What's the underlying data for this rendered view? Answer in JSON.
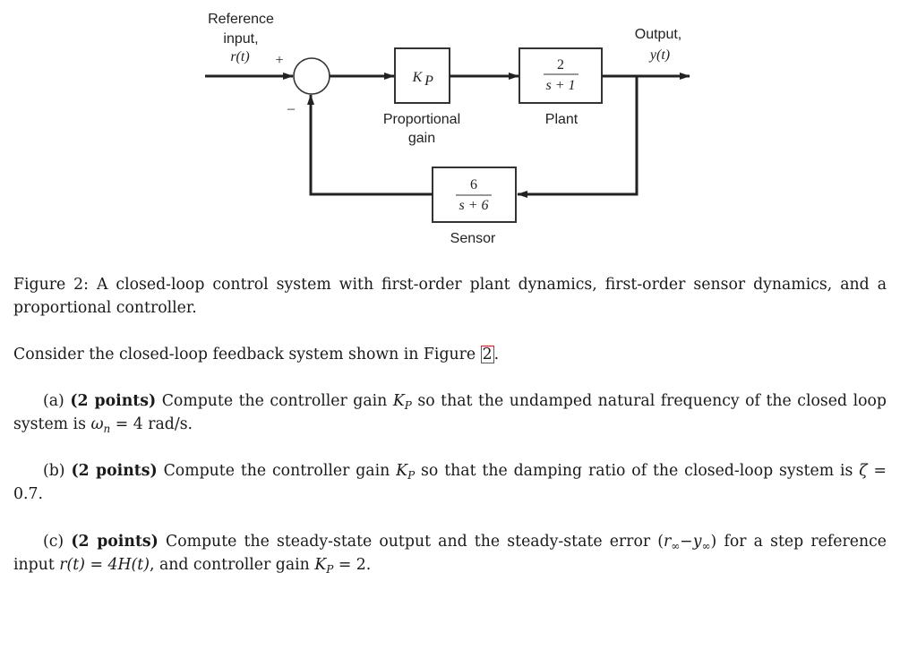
{
  "diagram": {
    "reference_label": [
      "Reference",
      "input,",
      "r(t)"
    ],
    "plus_sign": "+",
    "minus_sign": "–",
    "controller": {
      "symbol": "K",
      "subscript": "P",
      "caption": [
        "Proportional",
        "gain"
      ]
    },
    "plant": {
      "numerator": "2",
      "denominator": "s + 1",
      "caption": "Plant"
    },
    "sensor": {
      "numerator": "6",
      "denominator": "s + 6",
      "caption": "Sensor"
    },
    "output_label": [
      "Output,",
      "y(t)"
    ]
  },
  "caption": {
    "label": "Figure 2:",
    "text": "A closed-loop control system with first-order plant dynamics, first-order sensor dynamics, and a proportional controller."
  },
  "intro": {
    "before": "Consider the closed-loop feedback system shown in Figure",
    "ref": "2",
    "after": "."
  },
  "questions": [
    {
      "id": "(a)",
      "points": "(2 points)",
      "before": "Compute the controller gain",
      "kp": "K",
      "kp_sub": "P",
      "after": "so that the undamped natural frequency of the closed loop system is",
      "math_sym": "ω",
      "math_sub": "n",
      "math_rest": "= 4 rad/s."
    },
    {
      "id": "(b)",
      "points": "(2 points)",
      "before": "Compute the controller gain",
      "kp": "K",
      "kp_sub": "P",
      "after": "so that the damping ratio of the closed-loop system is",
      "math_sym": "ζ",
      "math_rest": "= 0.7."
    },
    {
      "id": "(c)",
      "points": "(2 points)",
      "before": "Compute the steady-state output and the steady-state error",
      "error_expr": {
        "r": "r",
        "y": "y",
        "inf": "∞",
        "minus": "−"
      },
      "mid": "for a step reference input",
      "input_expr": "r(t) = 4H(t)",
      "mid2": ", and controller gain",
      "kp": "K",
      "kp_sub": "P",
      "kp_val": "= 2."
    }
  ]
}
